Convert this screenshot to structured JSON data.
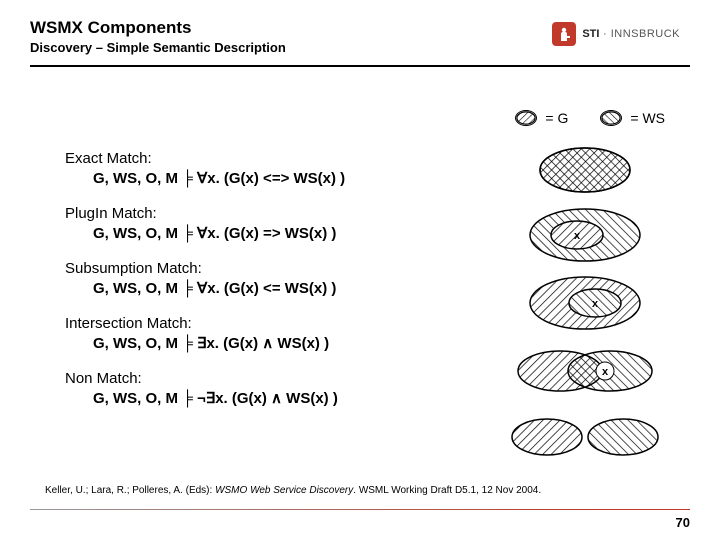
{
  "header": {
    "title": "WSMX Components",
    "subtitle": "Discovery – Simple Semantic Description"
  },
  "logo": {
    "brand_bold": "STI",
    "brand_light": " · INNSBRUCK"
  },
  "legend": {
    "g": "= G",
    "ws": "= WS"
  },
  "matches": [
    {
      "title": "Exact Match:",
      "formula": "G, WS, O, M ╞ ∀x. (G(x) <=> WS(x) )"
    },
    {
      "title": "PlugIn Match:",
      "formula": "G, WS, O, M ╞ ∀x. (G(x) => WS(x) )"
    },
    {
      "title": "Subsumption Match:",
      "formula": "G, WS, O, M ╞ ∀x. (G(x) <= WS(x) )"
    },
    {
      "title": "Intersection Match:",
      "formula": "G, WS, O, M ╞ ∃x. (G(x) ∧ WS(x) )"
    },
    {
      "title": "Non Match:",
      "formula": "G, WS, O, M ╞ ¬∃x. (G(x) ∧ WS(x) )"
    }
  ],
  "diagram_x": "x",
  "citation": {
    "authors": "Keller, U.; Lara, R.; Polleres, A. (Eds): ",
    "ital": "WSMO Web Service Discovery",
    "rest": ". WSML Working Draft D5.1, 12 Nov 2004."
  },
  "page": "70",
  "colors": {
    "accent": "#c0392b"
  }
}
